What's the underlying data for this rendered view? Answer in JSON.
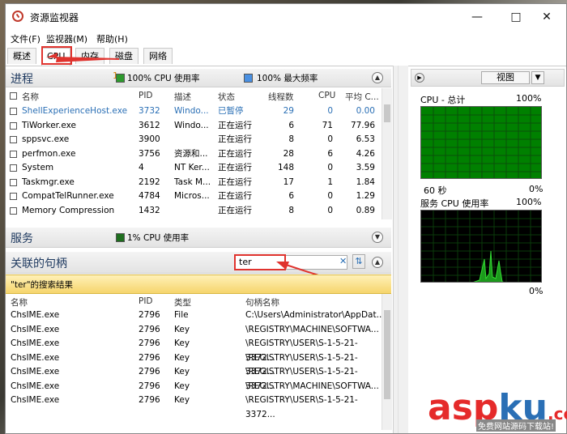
{
  "window": {
    "title": "资源监视器"
  },
  "menu": [
    "文件(F)",
    "监视器(M)",
    "帮助(H)"
  ],
  "tabs": [
    "概述",
    "CPU",
    "内存",
    "磁盘",
    "网络"
  ],
  "annotations": {
    "num1": "1",
    "num2": "2"
  },
  "processes": {
    "title": "进程",
    "cpu_usage": "100% CPU 使用率",
    "max_freq": "100% 最大频率",
    "columns": [
      "名称",
      "PID",
      "描述",
      "状态",
      "线程数",
      "CPU",
      "平均 C..."
    ],
    "rows": [
      [
        "ShellExperienceHost.exe",
        "3732",
        "Windo...",
        "已暂停",
        "29",
        "0",
        "0.00"
      ],
      [
        "TiWorker.exe",
        "3612",
        "Windo...",
        "正在运行",
        "6",
        "71",
        "77.96"
      ],
      [
        "sppsvc.exe",
        "3900",
        "",
        "正在运行",
        "8",
        "0",
        "6.53"
      ],
      [
        "perfmon.exe",
        "3756",
        "资源和...",
        "正在运行",
        "28",
        "6",
        "4.26"
      ],
      [
        "System",
        "4",
        "NT Ker...",
        "正在运行",
        "148",
        "0",
        "3.59"
      ],
      [
        "Taskmgr.exe",
        "2192",
        "Task M...",
        "正在运行",
        "17",
        "1",
        "1.84"
      ],
      [
        "CompatTelRunner.exe",
        "4784",
        "Micros...",
        "正在运行",
        "6",
        "0",
        "1.29"
      ],
      [
        "Memory Compression",
        "1432",
        "",
        "正在运行",
        "8",
        "0",
        "0.89"
      ]
    ]
  },
  "services": {
    "title": "服务",
    "cpu_usage": "1% CPU 使用率"
  },
  "handles": {
    "title": "关联的句柄",
    "search_value": "ter",
    "result_banner": "\"ter\"的搜索结果",
    "columns": [
      "名称",
      "PID",
      "类型",
      "句柄名称"
    ],
    "rows": [
      [
        "ChsIME.exe",
        "2796",
        "File",
        "C:\\Users\\Administrator\\AppDat..."
      ],
      [
        "ChsIME.exe",
        "2796",
        "Key",
        "\\REGISTRY\\MACHINE\\SOFTWA..."
      ],
      [
        "ChsIME.exe",
        "2796",
        "Key",
        "\\REGISTRY\\USER\\S-1-5-21-3372..."
      ],
      [
        "ChsIME.exe",
        "2796",
        "Key",
        "\\REGISTRY\\USER\\S-1-5-21-3372..."
      ],
      [
        "ChsIME.exe",
        "2796",
        "Key",
        "\\REGISTRY\\USER\\S-1-5-21-3372..."
      ],
      [
        "ChsIME.exe",
        "2796",
        "Key",
        "\\REGISTRY\\MACHINE\\SOFTWA..."
      ],
      [
        "ChsIME.exe",
        "2796",
        "Key",
        "\\REGISTRY\\USER\\S-1-5-21-3372..."
      ]
    ]
  },
  "right_panel": {
    "view_label": "视图",
    "cpu_total": {
      "label": "CPU - 总计",
      "top": "100%",
      "left_bottom": "60 秒",
      "right_bottom": "0%"
    },
    "service_cpu": {
      "label": "服务 CPU 使用率",
      "top": "100%",
      "right_bottom": "0%"
    }
  },
  "colors": {
    "graph_bg": "#008000",
    "red": "#e0332e",
    "link_blue": "#2a6fb5"
  },
  "watermark": {
    "main_a": "asp",
    "main_b": "ku",
    "main_c": ".com",
    "sub": "免费网站源码下载站!"
  }
}
